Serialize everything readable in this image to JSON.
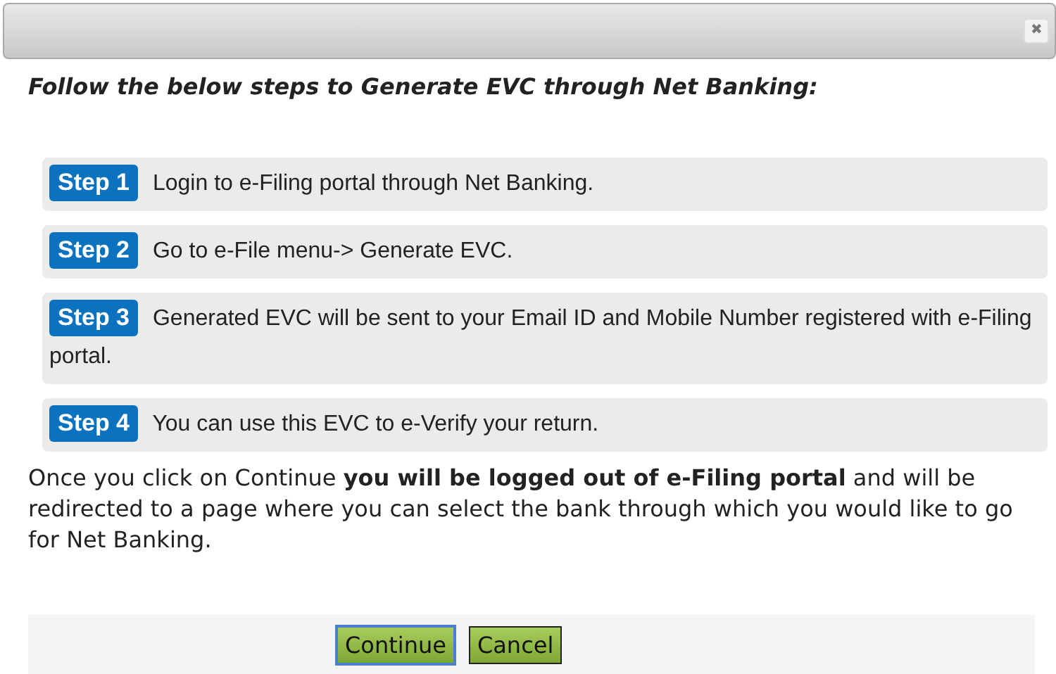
{
  "dialog": {
    "close_icon": "✖"
  },
  "heading": "Follow the below steps to Generate EVC through Net Banking:",
  "steps": [
    {
      "badge": "Step 1",
      "text": "Login to e-Filing portal through Net Banking."
    },
    {
      "badge": "Step 2",
      "text": "Go to e-File menu-> Generate EVC."
    },
    {
      "badge": "Step 3",
      "text": "Generated EVC will be sent to your Email ID and Mobile Number registered with e-Filing portal."
    },
    {
      "badge": "Step 4",
      "text": "You can use this EVC to e-Verify your return."
    }
  ],
  "note": "Once you click on Continue **you will be logged out of e-Filing portal** and will be redirected to a page where you can select the bank through which you would like to go for Net Banking.",
  "buttons": [
    {
      "label": "Continue",
      "focused": true
    },
    {
      "label": "Cancel",
      "focused": false
    }
  ]
}
